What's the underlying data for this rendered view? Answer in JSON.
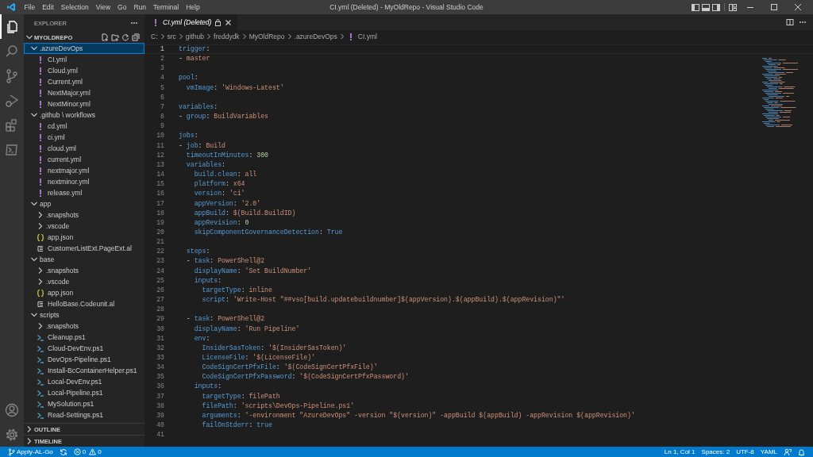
{
  "window": {
    "title": "CI.yml (Deleted) - MyOldRepo - Visual Studio Code",
    "menu": [
      "File",
      "Edit",
      "Selection",
      "View",
      "Go",
      "Run",
      "Terminal",
      "Help"
    ]
  },
  "activity_bar": {
    "top": [
      {
        "kind": "explorer",
        "selected": true
      },
      {
        "kind": "search",
        "selected": false
      },
      {
        "kind": "source-control",
        "selected": false
      },
      {
        "kind": "run",
        "selected": false
      },
      {
        "kind": "extensions",
        "selected": false
      },
      {
        "kind": "terminal",
        "selected": false
      }
    ],
    "bottom": [
      {
        "kind": "account"
      },
      {
        "kind": "settings"
      }
    ]
  },
  "sidebar": {
    "title": "EXPLORER",
    "root": {
      "label": "MYOLDREPO",
      "expanded": true
    },
    "tree": [
      {
        "kind": "folder",
        "label": ".azureDevOps",
        "expanded": true,
        "selected": true,
        "children": [
          {
            "kind": "yaml",
            "label": "CI.yml",
            "selected": false
          },
          {
            "kind": "yaml",
            "label": "Cloud.yml",
            "selected": false
          },
          {
            "kind": "yaml",
            "label": "Current.yml",
            "selected": false
          },
          {
            "kind": "yaml",
            "label": "NextMajor.yml",
            "selected": false
          },
          {
            "kind": "yaml",
            "label": "NextMinor.yml",
            "selected": false
          }
        ]
      },
      {
        "kind": "folder",
        "label": ".github \\ workflows",
        "expanded": true,
        "selected": false,
        "children": [
          {
            "kind": "yaml",
            "label": "cd.yml",
            "selected": false
          },
          {
            "kind": "yaml",
            "label": "ci.yml",
            "selected": false
          },
          {
            "kind": "yaml",
            "label": "cloud.yml",
            "selected": false
          },
          {
            "kind": "yaml",
            "label": "current.yml",
            "selected": false
          },
          {
            "kind": "yaml",
            "label": "nextmajor.yml",
            "selected": false
          },
          {
            "kind": "yaml",
            "label": "nextminor.yml",
            "selected": false
          },
          {
            "kind": "yaml",
            "label": "release.yml",
            "selected": false
          }
        ]
      },
      {
        "kind": "folder",
        "label": "app",
        "expanded": true,
        "selected": false,
        "children": [
          {
            "kind": "folder",
            "label": ".snapshots",
            "expanded": false,
            "selected": false
          },
          {
            "kind": "folder",
            "label": ".vscode",
            "expanded": false,
            "selected": false
          },
          {
            "kind": "json",
            "label": "app.json",
            "selected": false
          },
          {
            "kind": "al",
            "label": "CustomerListExt.PageExt.al",
            "selected": false
          }
        ]
      },
      {
        "kind": "folder",
        "label": "base",
        "expanded": true,
        "selected": false,
        "children": [
          {
            "kind": "folder",
            "label": ".snapshots",
            "expanded": false,
            "selected": false
          },
          {
            "kind": "folder",
            "label": ".vscode",
            "expanded": false,
            "selected": false
          },
          {
            "kind": "json",
            "label": "app.json",
            "selected": false
          },
          {
            "kind": "al",
            "label": "HelloBase.Codeunit.al",
            "selected": false
          }
        ]
      },
      {
        "kind": "folder",
        "label": "scripts",
        "expanded": true,
        "selected": false,
        "children": [
          {
            "kind": "folder",
            "label": ".snapshots",
            "expanded": false,
            "selected": false
          },
          {
            "kind": "ps1",
            "label": "Cleanup.ps1",
            "selected": false
          },
          {
            "kind": "ps1",
            "label": "Cloud-DevEnv.ps1",
            "selected": false
          },
          {
            "kind": "ps1",
            "label": "DevOps-Pipeline.ps1",
            "selected": false
          },
          {
            "kind": "ps1",
            "label": "Install-BcContainerHelper.ps1",
            "selected": false
          },
          {
            "kind": "ps1",
            "label": "Local-DevEnv.ps1",
            "selected": false
          },
          {
            "kind": "ps1",
            "label": "Local-Pipeline.ps1",
            "selected": false
          },
          {
            "kind": "ps1",
            "label": "MySolution.ps1",
            "selected": false
          },
          {
            "kind": "ps1",
            "label": "Read-Settings.ps1",
            "selected": false
          }
        ]
      }
    ],
    "sections": [
      {
        "label": "OUTLINE",
        "expanded": false
      },
      {
        "label": "TIMELINE",
        "expanded": false
      }
    ]
  },
  "tabs": [
    {
      "label": "CI.yml (Deleted)",
      "selected": true,
      "preview": true
    }
  ],
  "breadcrumbs": [
    {
      "kind": "folder",
      "label": "C:"
    },
    {
      "kind": "folder",
      "label": "src"
    },
    {
      "kind": "folder",
      "label": "github"
    },
    {
      "kind": "folder",
      "label": "freddydk"
    },
    {
      "kind": "folder",
      "label": "MyOldRepo"
    },
    {
      "kind": "folder",
      "label": ".azureDevOps"
    },
    {
      "kind": "yaml",
      "label": "CI.yml"
    }
  ],
  "editor": {
    "lines": [
      {
        "number": "1",
        "current": true,
        "tokens": [
          {
            "kind": "key",
            "text": "trigger"
          },
          {
            "kind": "plain",
            "text": ":"
          }
        ]
      },
      {
        "number": "2",
        "current": false,
        "tokens": [
          {
            "kind": "plain",
            "text": "- "
          },
          {
            "kind": "string",
            "text": "master"
          }
        ]
      },
      {
        "number": "3",
        "current": false
      },
      {
        "number": "4",
        "current": false,
        "tokens": [
          {
            "kind": "key",
            "text": "pool"
          },
          {
            "kind": "plain",
            "text": ":"
          }
        ]
      },
      {
        "number": "5",
        "current": false,
        "tokens": [
          {
            "kind": "key",
            "text": "  vmImage"
          },
          {
            "kind": "plain",
            "text": ": "
          },
          {
            "kind": "string",
            "text": "'Windows-Latest'"
          }
        ]
      },
      {
        "number": "6",
        "current": false
      },
      {
        "number": "7",
        "current": false,
        "tokens": [
          {
            "kind": "key",
            "text": "variables"
          },
          {
            "kind": "plain",
            "text": ":"
          }
        ]
      },
      {
        "number": "8",
        "current": false,
        "tokens": [
          {
            "kind": "plain",
            "text": "- "
          },
          {
            "kind": "key",
            "text": "group"
          },
          {
            "kind": "plain",
            "text": ": "
          },
          {
            "kind": "string",
            "text": "BuildVariables"
          }
        ]
      },
      {
        "number": "9",
        "current": false
      },
      {
        "number": "10",
        "current": false,
        "tokens": [
          {
            "kind": "key",
            "text": "jobs"
          },
          {
            "kind": "plain",
            "text": ":"
          }
        ]
      },
      {
        "number": "11",
        "current": false,
        "tokens": [
          {
            "kind": "plain",
            "text": "- "
          },
          {
            "kind": "key",
            "text": "job"
          },
          {
            "kind": "plain",
            "text": ": "
          },
          {
            "kind": "string",
            "text": "Build"
          }
        ]
      },
      {
        "number": "12",
        "current": false,
        "tokens": [
          {
            "kind": "key",
            "text": "  timeoutInMinutes"
          },
          {
            "kind": "plain",
            "text": ": "
          },
          {
            "kind": "number",
            "text": "300"
          }
        ]
      },
      {
        "number": "13",
        "current": false,
        "tokens": [
          {
            "kind": "key",
            "text": "  variables"
          },
          {
            "kind": "plain",
            "text": ":"
          }
        ]
      },
      {
        "number": "14",
        "current": false,
        "tokens": [
          {
            "kind": "key",
            "text": "    build.clean"
          },
          {
            "kind": "plain",
            "text": ": "
          },
          {
            "kind": "string",
            "text": "all"
          }
        ]
      },
      {
        "number": "15",
        "current": false,
        "tokens": [
          {
            "kind": "key",
            "text": "    platform"
          },
          {
            "kind": "plain",
            "text": ": "
          },
          {
            "kind": "string",
            "text": "x64"
          }
        ]
      },
      {
        "number": "16",
        "current": false,
        "tokens": [
          {
            "kind": "key",
            "text": "    version"
          },
          {
            "kind": "plain",
            "text": ": "
          },
          {
            "kind": "string",
            "text": "'ci'"
          }
        ]
      },
      {
        "number": "17",
        "current": false,
        "tokens": [
          {
            "kind": "key",
            "text": "    appVersion"
          },
          {
            "kind": "plain",
            "text": ": "
          },
          {
            "kind": "string",
            "text": "'2.0'"
          }
        ]
      },
      {
        "number": "18",
        "current": false,
        "tokens": [
          {
            "kind": "key",
            "text": "    appBuild"
          },
          {
            "kind": "plain",
            "text": ": "
          },
          {
            "kind": "string",
            "text": "$(Build.BuildID)"
          }
        ]
      },
      {
        "number": "19",
        "current": false,
        "tokens": [
          {
            "kind": "key",
            "text": "    appRevision"
          },
          {
            "kind": "plain",
            "text": ": "
          },
          {
            "kind": "number",
            "text": "0"
          }
        ]
      },
      {
        "number": "20",
        "current": false,
        "tokens": [
          {
            "kind": "key",
            "text": "    skipComponentGovernanceDetection"
          },
          {
            "kind": "plain",
            "text": ": "
          },
          {
            "kind": "keyword",
            "text": "True"
          }
        ]
      },
      {
        "number": "21",
        "current": false
      },
      {
        "number": "22",
        "current": false,
        "tokens": [
          {
            "kind": "key",
            "text": "  steps"
          },
          {
            "kind": "plain",
            "text": ":"
          }
        ]
      },
      {
        "number": "23",
        "current": false,
        "tokens": [
          {
            "kind": "plain",
            "text": "  - "
          },
          {
            "kind": "key",
            "text": "task"
          },
          {
            "kind": "plain",
            "text": ": "
          },
          {
            "kind": "string",
            "text": "PowerShell@2"
          }
        ]
      },
      {
        "number": "24",
        "current": false,
        "tokens": [
          {
            "kind": "key",
            "text": "    displayName"
          },
          {
            "kind": "plain",
            "text": ": "
          },
          {
            "kind": "string",
            "text": "'Set BuildNumber'"
          }
        ]
      },
      {
        "number": "25",
        "current": false,
        "tokens": [
          {
            "kind": "key",
            "text": "    inputs"
          },
          {
            "kind": "plain",
            "text": ":"
          }
        ]
      },
      {
        "number": "26",
        "current": false,
        "tokens": [
          {
            "kind": "key",
            "text": "      targetType"
          },
          {
            "kind": "plain",
            "text": ": "
          },
          {
            "kind": "string",
            "text": "inline"
          }
        ]
      },
      {
        "number": "27",
        "current": false,
        "tokens": [
          {
            "kind": "key",
            "text": "      script"
          },
          {
            "kind": "plain",
            "text": ": "
          },
          {
            "kind": "string",
            "text": "'Write-Host \"##vso[build.updatebuildnumber]$(appVersion).$(appBuild).$(appRevision)\"'"
          }
        ]
      },
      {
        "number": "28",
        "current": false
      },
      {
        "number": "29",
        "current": false,
        "tokens": [
          {
            "kind": "plain",
            "text": "  - "
          },
          {
            "kind": "key",
            "text": "task"
          },
          {
            "kind": "plain",
            "text": ": "
          },
          {
            "kind": "string",
            "text": "PowerShell@2"
          }
        ]
      },
      {
        "number": "30",
        "current": false,
        "tokens": [
          {
            "kind": "key",
            "text": "    displayName"
          },
          {
            "kind": "plain",
            "text": ": "
          },
          {
            "kind": "string",
            "text": "'Run Pipeline'"
          }
        ]
      },
      {
        "number": "31",
        "current": false,
        "tokens": [
          {
            "kind": "key",
            "text": "    env"
          },
          {
            "kind": "plain",
            "text": ":"
          }
        ]
      },
      {
        "number": "32",
        "current": false,
        "tokens": [
          {
            "kind": "key",
            "text": "      InsiderSasToken"
          },
          {
            "kind": "plain",
            "text": ": "
          },
          {
            "kind": "string",
            "text": "'$(InsiderSasToken)'"
          }
        ]
      },
      {
        "number": "33",
        "current": false,
        "tokens": [
          {
            "kind": "key",
            "text": "      LicenseFile"
          },
          {
            "kind": "plain",
            "text": ": "
          },
          {
            "kind": "string",
            "text": "'$(LicenseFile)'"
          }
        ]
      },
      {
        "number": "34",
        "current": false,
        "tokens": [
          {
            "kind": "key",
            "text": "      CodeSignCertPfxFile"
          },
          {
            "kind": "plain",
            "text": ": "
          },
          {
            "kind": "string",
            "text": "'$(CodeSignCertPfxFile)'"
          }
        ]
      },
      {
        "number": "35",
        "current": false,
        "tokens": [
          {
            "kind": "key",
            "text": "      CodeSignCertPfxPassword"
          },
          {
            "kind": "plain",
            "text": ": "
          },
          {
            "kind": "string",
            "text": "'$(CodeSignCertPfxPassword)'"
          }
        ]
      },
      {
        "number": "36",
        "current": false,
        "tokens": [
          {
            "kind": "key",
            "text": "    inputs"
          },
          {
            "kind": "plain",
            "text": ":"
          }
        ]
      },
      {
        "number": "37",
        "current": false,
        "tokens": [
          {
            "kind": "key",
            "text": "      targetType"
          },
          {
            "kind": "plain",
            "text": ": "
          },
          {
            "kind": "string",
            "text": "filePath"
          }
        ]
      },
      {
        "number": "38",
        "current": false,
        "tokens": [
          {
            "kind": "key",
            "text": "      filePath"
          },
          {
            "kind": "plain",
            "text": ": "
          },
          {
            "kind": "string",
            "text": "'scripts\\DevOps-Pipeline.ps1'"
          }
        ]
      },
      {
        "number": "39",
        "current": false,
        "tokens": [
          {
            "kind": "key",
            "text": "      arguments"
          },
          {
            "kind": "plain",
            "text": ": "
          },
          {
            "kind": "string",
            "text": "'-environment \"AzureDevOps\" -version \"$(version)\" -appBuild $(appBuild) -appRevision $(appRevision)'"
          }
        ]
      },
      {
        "number": "40",
        "current": false,
        "tokens": [
          {
            "kind": "key",
            "text": "      failOnStderr"
          },
          {
            "kind": "plain",
            "text": ": "
          },
          {
            "kind": "keyword",
            "text": "true"
          }
        ]
      },
      {
        "number": "41",
        "current": false
      }
    ]
  },
  "status_bar": {
    "left": [
      {
        "kind": "branch",
        "text": "Apply-AL-Go"
      },
      {
        "kind": "sync"
      },
      {
        "kind": "problems",
        "errors": "0",
        "warnings": "0"
      }
    ],
    "right": [
      {
        "kind": "position",
        "text": "Ln 1, Col 1"
      },
      {
        "kind": "indent",
        "text": "Spaces: 2"
      },
      {
        "kind": "encoding",
        "text": "UTF-8"
      },
      {
        "kind": "language",
        "text": "YAML"
      },
      {
        "kind": "feedback"
      },
      {
        "kind": "notifications"
      }
    ]
  }
}
